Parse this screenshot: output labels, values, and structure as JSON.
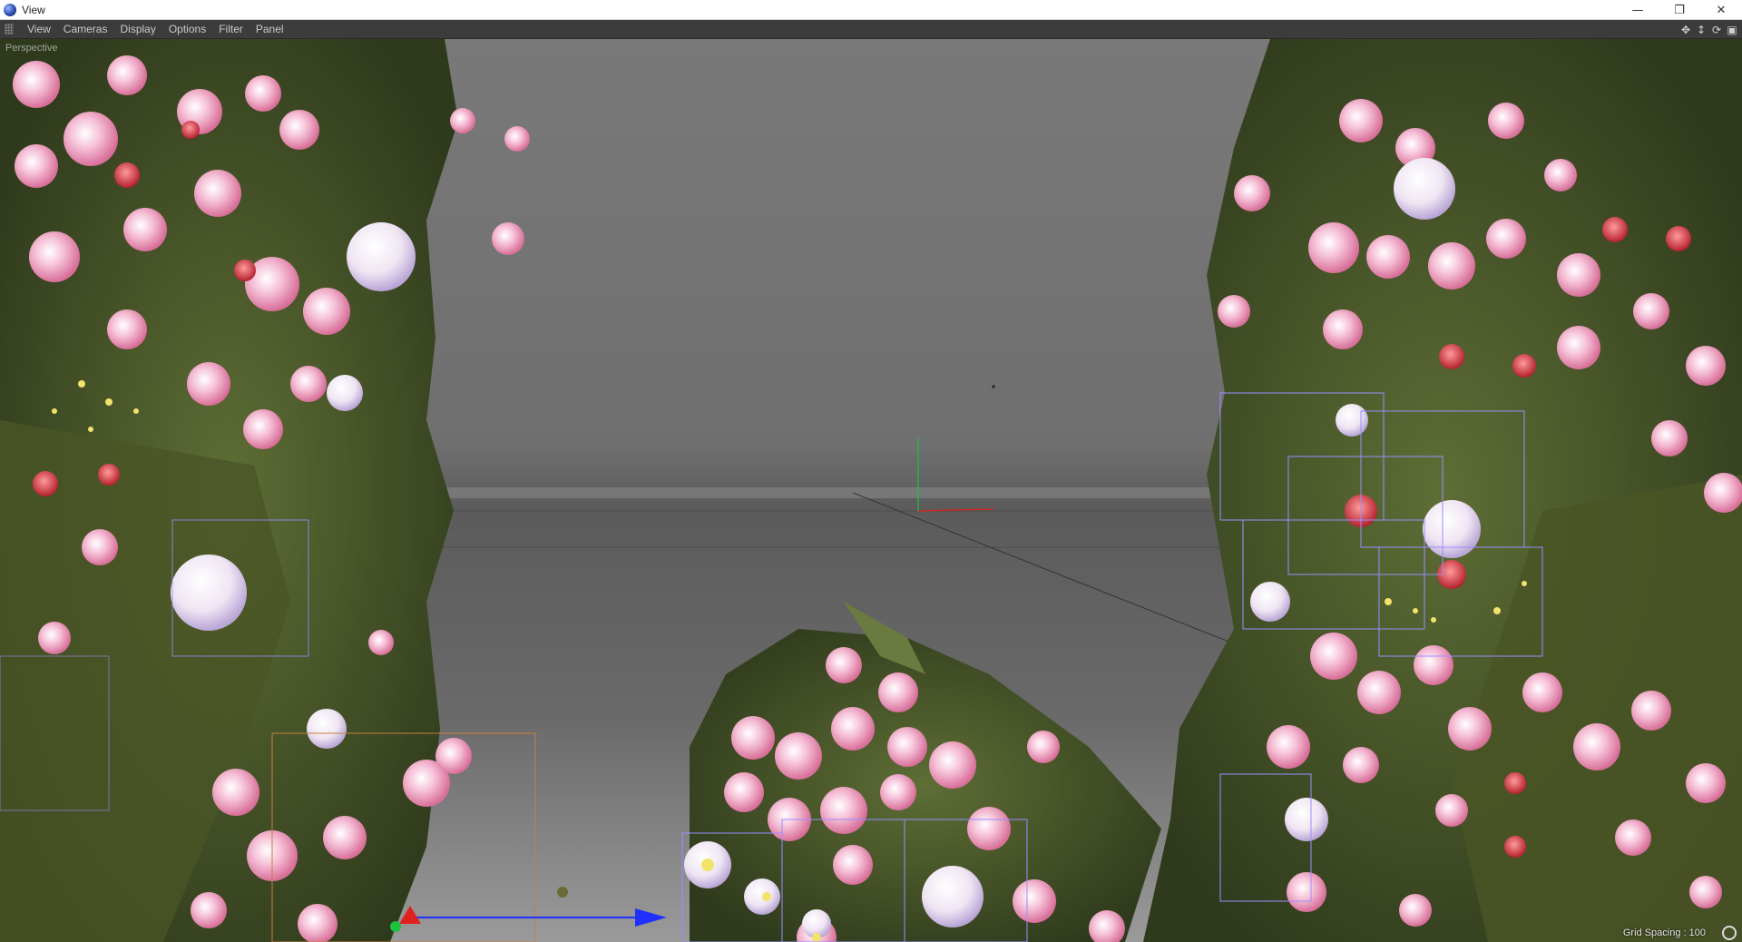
{
  "window": {
    "title": "View",
    "controls": {
      "minimize": "—",
      "restore": "❐",
      "close": "✕"
    }
  },
  "menubar": {
    "items": [
      "View",
      "Cameras",
      "Display",
      "Options",
      "Filter",
      "Panel"
    ]
  },
  "viewport": {
    "label": "Perspective",
    "grid_spacing": "Grid Spacing : 100"
  },
  "icons": {
    "app": "cinema4d-logo-icon",
    "nav": [
      "move-view-icon",
      "zoom-view-icon",
      "rotate-view-icon",
      "toggle-layout-icon"
    ]
  },
  "colors": {
    "background_top": "#797979",
    "background_floor": "#6a6a6a",
    "menubar": "#3c3c3c",
    "selection_box": "#9a8fff",
    "axis_x": "#e02020",
    "axis_y": "#20c040",
    "axis_z": "#2030ff"
  }
}
